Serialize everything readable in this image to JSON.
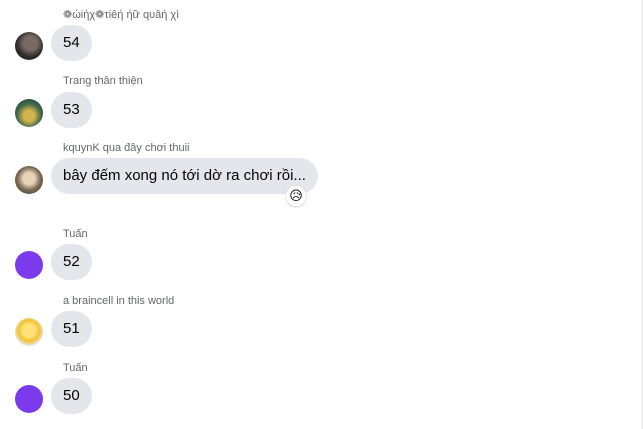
{
  "messages": [
    {
      "sender": "❁ώiήχ❁τiêή ήữ qυâή χì",
      "text": "54",
      "avatar": "profile-photo-dark"
    },
    {
      "sender": "Trang thân thiện",
      "text": "53",
      "avatar": "profile-photo-green"
    },
    {
      "sender": "kquynK qua đây chơi thuii",
      "text": "bây đếm xong nó tới dờ ra chơi rồi...",
      "avatar": "profile-photo-brown",
      "reaction": "😥"
    },
    {
      "sender": "Tuấn",
      "text": "52",
      "avatar": "solid-purple"
    },
    {
      "sender": "a braincell in this world",
      "text": "51",
      "avatar": "profile-photo-yellow"
    },
    {
      "sender": "Tuấn",
      "text": "50",
      "avatar": "solid-purple"
    }
  ],
  "colors": {
    "bubble_bg": "#e4e6eb",
    "sender_text": "#65676b",
    "message_text": "#050505",
    "purple_avatar": "#7c3aed"
  }
}
